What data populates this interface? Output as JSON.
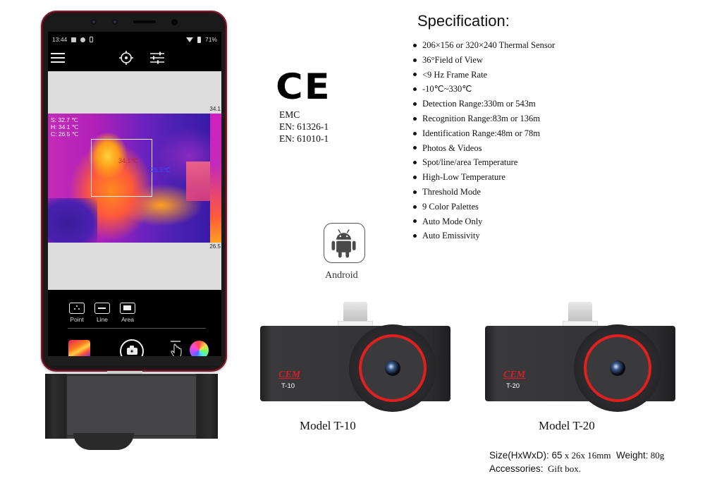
{
  "phone": {
    "status_bar": {
      "time": "13:44",
      "battery": "71%",
      "icons": [
        "image-icon",
        "shield-icon",
        "phone-icon",
        "wifi-icon",
        "battery-icon"
      ]
    },
    "app_bar": {
      "icons": [
        "menu-icon",
        "crosshair-target-icon",
        "sliders-icon"
      ]
    },
    "thermal_view": {
      "readouts": {
        "spot": "S:  32.7 ℃",
        "high": "H:  34.1 ℃",
        "cold": "C:  26.5 ℃"
      },
      "hot_marker": "34.1℃",
      "cold_marker": "26.5℃",
      "scale_max": "34.1",
      "scale_min": "26.5"
    },
    "measure_modes": [
      {
        "label": "Point",
        "icon": "point-icon"
      },
      {
        "label": "Line",
        "icon": "line-icon"
      },
      {
        "label": "Area",
        "icon": "area-icon"
      }
    ],
    "bottom_controls": [
      "palette-thumbnail",
      "camera-shutter-icon",
      "touch-icon",
      "color-wheel-icon"
    ]
  },
  "certification": {
    "mark": "CE",
    "lines": [
      "EMC",
      "EN: 61326-1",
      "EN: 61010-1"
    ]
  },
  "specification": {
    "title": "Specification:",
    "items": [
      "206×156 or 320×240 Thermal Sensor",
      "36°Field of View",
      "<9 Hz Frame Rate",
      "-10℃~330℃",
      "Detection Range:330m or 543m",
      "Recognition Range:83m or 136m",
      "Identification Range:48m or 78m",
      "Photos & Videos",
      "Spot/line/area Temperature",
      "High-Low Temperature",
      "Threshold Mode",
      "9 Color Palettes",
      "Auto Mode Only",
      "Auto Emissivity"
    ]
  },
  "platform": {
    "label": "Android",
    "icon": "android-icon"
  },
  "devices": [
    {
      "brand": "CEM",
      "code": "T-10",
      "caption": "Model T-10"
    },
    {
      "brand": "CEM",
      "code": "T-20",
      "caption": "Model T-20"
    }
  ],
  "footer": {
    "size_label": "Size(HxWxD): 65",
    "size_rest": " x 26x 16mm",
    "weight_label": "  Weight:",
    "weight_value": " 80g",
    "accessories_label": "Accessories:",
    "accessories_value": "  Gift box."
  },
  "colors": {
    "phone_frame": "#7a1c2c",
    "lens_ring": "#e0201e",
    "brand_red": "#d0202a"
  }
}
